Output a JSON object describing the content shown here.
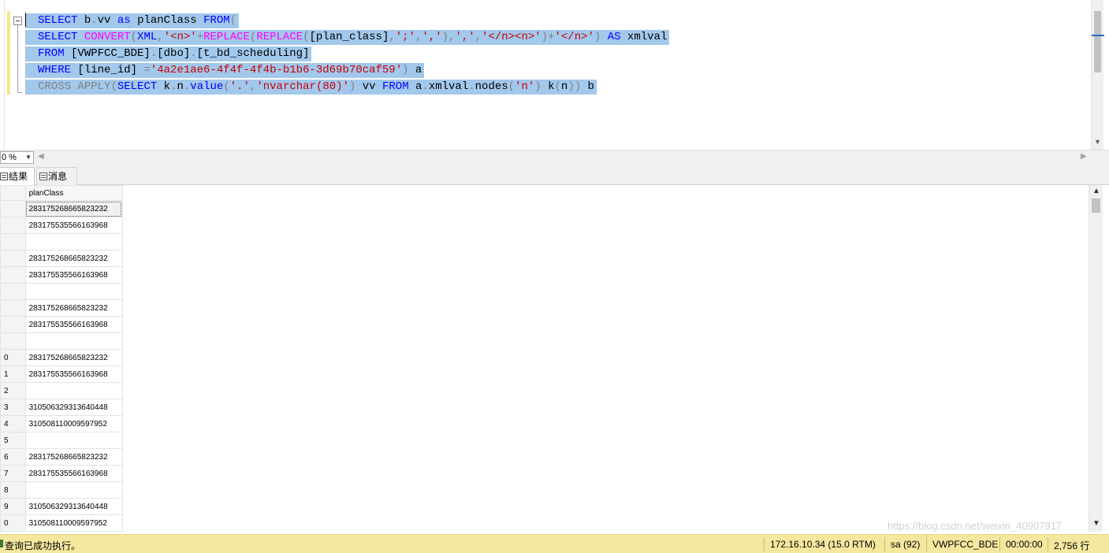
{
  "editor": {
    "lines": [
      [
        {
          "t": "SELECT",
          "c": "kw"
        },
        {
          "t": " b",
          "c": "plain"
        },
        {
          "t": ".",
          "c": "gray"
        },
        {
          "t": "vv ",
          "c": "plain"
        },
        {
          "t": "as",
          "c": "kw"
        },
        {
          "t": " planClass ",
          "c": "plain"
        },
        {
          "t": "FROM",
          "c": "kw"
        },
        {
          "t": "(",
          "c": "gray"
        }
      ],
      [
        {
          "t": "SELECT",
          "c": "kw"
        },
        {
          "t": " ",
          "c": "plain"
        },
        {
          "t": "CONVERT",
          "c": "fn"
        },
        {
          "t": "(",
          "c": "gray"
        },
        {
          "t": "XML",
          "c": "kw"
        },
        {
          "t": ",",
          "c": "gray"
        },
        {
          "t": "'<n>'",
          "c": "str"
        },
        {
          "t": "+",
          "c": "gray"
        },
        {
          "t": "REPLACE",
          "c": "fn"
        },
        {
          "t": "(",
          "c": "gray"
        },
        {
          "t": "REPLACE",
          "c": "fn"
        },
        {
          "t": "(",
          "c": "gray"
        },
        {
          "t": "[plan_class]",
          "c": "plain"
        },
        {
          "t": ",",
          "c": "gray"
        },
        {
          "t": "';'",
          "c": "str"
        },
        {
          "t": ",",
          "c": "gray"
        },
        {
          "t": "','",
          "c": "str"
        },
        {
          "t": "),",
          "c": "gray"
        },
        {
          "t": "','",
          "c": "str"
        },
        {
          "t": ",",
          "c": "gray"
        },
        {
          "t": "'</n><n>'",
          "c": "str"
        },
        {
          "t": ")+",
          "c": "gray"
        },
        {
          "t": "'</n>'",
          "c": "str"
        },
        {
          "t": ") ",
          "c": "gray"
        },
        {
          "t": "AS",
          "c": "kw"
        },
        {
          "t": " xmlval",
          "c": "plain"
        }
      ],
      [
        {
          "t": "FROM",
          "c": "kw"
        },
        {
          "t": " [VWPFCC_BDE]",
          "c": "plain"
        },
        {
          "t": ".",
          "c": "gray"
        },
        {
          "t": "[dbo]",
          "c": "plain"
        },
        {
          "t": ".",
          "c": "gray"
        },
        {
          "t": "[t_bd_scheduling]",
          "c": "plain"
        }
      ],
      [
        {
          "t": "WHERE",
          "c": "kw"
        },
        {
          "t": " [line_id] ",
          "c": "plain"
        },
        {
          "t": "=",
          "c": "gray"
        },
        {
          "t": "'4a2e1ae6-4f4f-4f4b-b1b6-3d69b70caf59'",
          "c": "str"
        },
        {
          "t": ") ",
          "c": "gray"
        },
        {
          "t": "a",
          "c": "plain"
        }
      ],
      [
        {
          "t": "CROSS",
          "c": "gray"
        },
        {
          "t": " ",
          "c": "plain"
        },
        {
          "t": "APPLY",
          "c": "gray"
        },
        {
          "t": "(",
          "c": "gray"
        },
        {
          "t": "SELECT",
          "c": "kw"
        },
        {
          "t": " k",
          "c": "plain"
        },
        {
          "t": ".",
          "c": "gray"
        },
        {
          "t": "n",
          "c": "plain"
        },
        {
          "t": ".",
          "c": "gray"
        },
        {
          "t": "value",
          "c": "kw"
        },
        {
          "t": "(",
          "c": "gray"
        },
        {
          "t": "'.'",
          "c": "str"
        },
        {
          "t": ",",
          "c": "gray"
        },
        {
          "t": "'nvarchar(80)'",
          "c": "str"
        },
        {
          "t": ") ",
          "c": "gray"
        },
        {
          "t": "vv ",
          "c": "plain"
        },
        {
          "t": "FROM",
          "c": "kw"
        },
        {
          "t": " a",
          "c": "plain"
        },
        {
          "t": ".",
          "c": "gray"
        },
        {
          "t": "xmlval",
          "c": "plain"
        },
        {
          "t": ".",
          "c": "gray"
        },
        {
          "t": "nodes",
          "c": "plain"
        },
        {
          "t": "(",
          "c": "gray"
        },
        {
          "t": "'n'",
          "c": "str"
        },
        {
          "t": ") ",
          "c": "gray"
        },
        {
          "t": "k",
          "c": "plain"
        },
        {
          "t": "(",
          "c": "gray"
        },
        {
          "t": "n",
          "c": "plain"
        },
        {
          "t": ")) ",
          "c": "gray"
        },
        {
          "t": "b",
          "c": "plain"
        }
      ]
    ]
  },
  "zoom": {
    "value": "0 %"
  },
  "tabs": {
    "results": "结果",
    "messages": "消息"
  },
  "grid": {
    "column": "planClass",
    "rows": [
      {
        "n": "",
        "v": "283175268665823232"
      },
      {
        "n": "",
        "v": "283175535566163968"
      },
      {
        "n": "",
        "v": ""
      },
      {
        "n": "",
        "v": "283175268665823232"
      },
      {
        "n": "",
        "v": "283175535566163968"
      },
      {
        "n": "",
        "v": ""
      },
      {
        "n": "",
        "v": "283175268665823232"
      },
      {
        "n": "",
        "v": "283175535566163968"
      },
      {
        "n": "",
        "v": ""
      },
      {
        "n": "0",
        "v": "283175268665823232"
      },
      {
        "n": "1",
        "v": "283175535566163968"
      },
      {
        "n": "2",
        "v": ""
      },
      {
        "n": "3",
        "v": "310506329313640448"
      },
      {
        "n": "4",
        "v": "310508110009597952"
      },
      {
        "n": "5",
        "v": ""
      },
      {
        "n": "6",
        "v": "283175268665823232"
      },
      {
        "n": "7",
        "v": "283175535566163968"
      },
      {
        "n": "8",
        "v": ""
      },
      {
        "n": "9",
        "v": "310506329313640448"
      },
      {
        "n": "0",
        "v": "310508110009597952"
      }
    ]
  },
  "watermark": "https://blog.csdn.net/weixin_40907917",
  "status": {
    "message": "查询已成功执行。",
    "server": "172.16.10.34 (15.0 RTM)",
    "user": "sa (92)",
    "database": "VWPFCC_BDE",
    "elapsed": "00:00:00",
    "rows": "2,756 行"
  },
  "colors": {
    "selection": "#a2c8ec",
    "status_bar": "#f5e79e",
    "keyword": "#0000ff",
    "function": "#ff00ff",
    "string": "#c80000"
  }
}
